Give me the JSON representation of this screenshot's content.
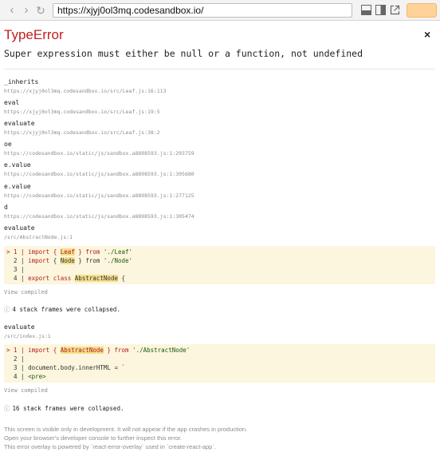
{
  "browser": {
    "url": "https://xjyj0ol3mq.codesandbox.io/",
    "back_icon": "chevron-left-icon",
    "forward_icon": "chevron-right-icon",
    "reload_icon": "reload-icon",
    "accent": "#ffd29a"
  },
  "error": {
    "title": "TypeError",
    "close": "×",
    "message": "Super expression must either be null or a function, not undefined",
    "title_color": "#c01e1e"
  },
  "frames": [
    {
      "name": "_inherits",
      "location": "https://xjyj0ol3mq.codesandbox.io/src/Leaf.js:16:113"
    },
    {
      "name": "eval",
      "location": "https://xjyj0ol3mq.codesandbox.io/src/Leaf.js:19:5"
    },
    {
      "name": "evaluate",
      "location": "https://xjyj0ol3mq.codesandbox.io/src/Leaf.js:38:2"
    },
    {
      "name": "oe",
      "location": "https://codesandbox.io/static/js/sandbox.a8898593.js:1:293759"
    },
    {
      "name": "e.value",
      "location": "https://codesandbox.io/static/js/sandbox.a8898593.js:1:305680"
    },
    {
      "name": "e.value",
      "location": "https://codesandbox.io/static/js/sandbox.a8898593.js:1:277125"
    },
    {
      "name": "d",
      "location": "https://codesandbox.io/static/js/sandbox.a8898593.js:1:305474"
    },
    {
      "name": "evaluate",
      "location": "/src/AbstractNode.js:1"
    }
  ],
  "code1": {
    "lines": [
      {
        "marker": ">",
        "num": "1",
        "kw1": "import",
        "pre": " { ",
        "id": "Leaf",
        "post": " } from ",
        "str": "'./Leaf'"
      },
      {
        "marker": " ",
        "num": "2",
        "kw1": "import",
        "pre": " { ",
        "id": "Node",
        "post": " } from ",
        "str": "'./Node'"
      },
      {
        "marker": " ",
        "num": "3",
        "text": ""
      },
      {
        "marker": " ",
        "num": "4",
        "kw1": "export class",
        "pre": " ",
        "id": "AbstractNode",
        "post": " {",
        "str": ""
      }
    ]
  },
  "view_compiled_1": "View compiled",
  "collapsed_1": "4 stack frames were collapsed.",
  "frame2": {
    "name": "evaluate",
    "location": "/src/index.js:1"
  },
  "code2": {
    "lines": [
      {
        "marker": ">",
        "num": "1",
        "kw1": "import",
        "pre": " { ",
        "id": "AbstractNode",
        "post": " } from ",
        "str": "'./AbstractNode'"
      },
      {
        "marker": " ",
        "num": "2",
        "text": ""
      },
      {
        "marker": " ",
        "num": "3",
        "text": "document.body.innerHTML = `"
      },
      {
        "marker": " ",
        "num": "4",
        "text": "<pre>"
      }
    ]
  },
  "view_compiled_2": "View compiled",
  "collapsed_2": "16 stack frames were collapsed.",
  "collapsed_icon": "circled-info-icon",
  "footer": [
    "This screen is visible only in development. It will not appear if the app crashes in production.",
    "Open your browser's developer console to further inspect this error.",
    "This error overlay is powered by `react-error-overlay` used in `create-react-app`."
  ]
}
